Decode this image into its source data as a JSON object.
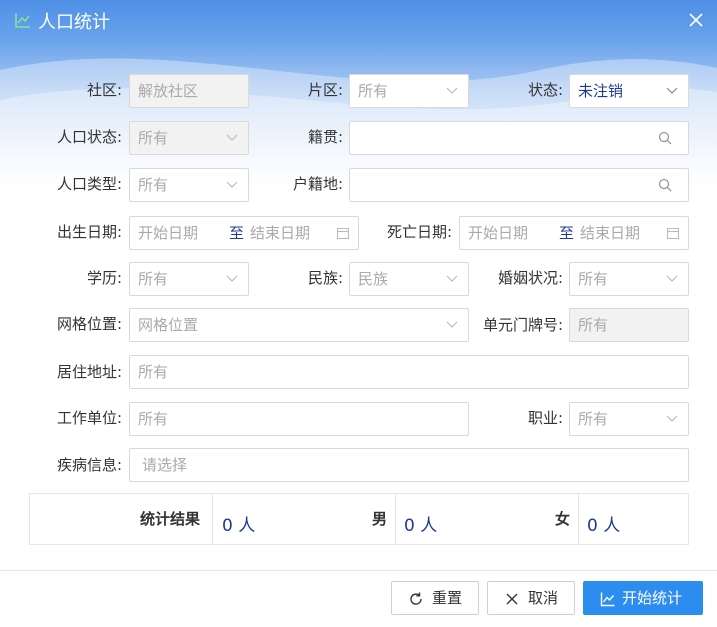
{
  "dialog": {
    "title": "人口统计"
  },
  "form": {
    "community": {
      "label": "社区:",
      "value": "解放社区"
    },
    "district": {
      "label": "片区:",
      "value": "所有"
    },
    "status": {
      "label": "状态:",
      "value": "未注销"
    },
    "population_status": {
      "label": "人口状态:",
      "value": "所有"
    },
    "native_place": {
      "label": "籍贯:",
      "value": ""
    },
    "population_type": {
      "label": "人口类型:",
      "value": "所有"
    },
    "household_place": {
      "label": "户籍地:",
      "value": ""
    },
    "birth_date": {
      "label": "出生日期:",
      "start_placeholder": "开始日期",
      "sep": "至",
      "end_placeholder": "结束日期"
    },
    "death_date": {
      "label": "死亡日期:",
      "start_placeholder": "开始日期",
      "sep": "至",
      "end_placeholder": "结束日期"
    },
    "education": {
      "label": "学历:",
      "value": "所有"
    },
    "ethnicity": {
      "label": "民族:",
      "value": "民族"
    },
    "marital_status": {
      "label": "婚姻状况:",
      "value": "所有"
    },
    "grid_location": {
      "label": "网格位置:",
      "value": "网格位置"
    },
    "unit_number": {
      "label": "单元门牌号:",
      "value": "所有"
    },
    "address": {
      "label": "居住地址:",
      "value": "所有"
    },
    "workplace": {
      "label": "工作单位:",
      "value": "所有"
    },
    "occupation": {
      "label": "职业:",
      "value": "所有"
    },
    "disease": {
      "label": "疾病信息:",
      "value": "请选择"
    }
  },
  "result": {
    "label": "统计结果",
    "total": "0 人",
    "male_label": "男",
    "male": "0 人",
    "female_label": "女",
    "female": "0 人"
  },
  "buttons": {
    "reset": "重置",
    "cancel": "取消",
    "start": "开始统计"
  },
  "colors": {
    "header": "#4e8fe6",
    "primary": "#2d8cf0",
    "value_text": "#1f3a93"
  }
}
